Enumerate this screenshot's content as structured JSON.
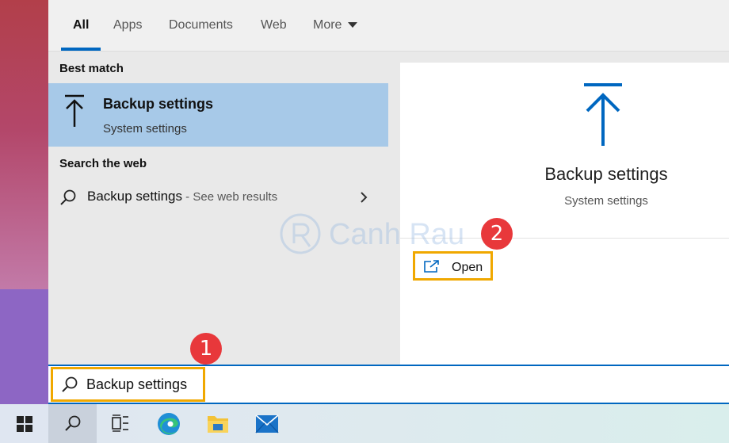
{
  "tabs": [
    {
      "label": "All",
      "active": true
    },
    {
      "label": "Apps"
    },
    {
      "label": "Documents"
    },
    {
      "label": "Web"
    },
    {
      "label": "More"
    }
  ],
  "left": {
    "best_match_heading": "Best match",
    "best_match": {
      "title": "Backup settings",
      "subtitle": "System settings",
      "icon": "backup-arrow-icon"
    },
    "web_heading": "Search the web",
    "web_result": {
      "text": "Backup settings",
      "hint": " - See web results"
    }
  },
  "preview": {
    "title": "Backup settings",
    "subtitle": "System settings",
    "open_label": "Open",
    "icon": "backup-arrow-icon"
  },
  "watermark": {
    "text": "Canh Rau"
  },
  "badges": {
    "one": "1",
    "two": "2"
  },
  "search": {
    "value": "Backup settings"
  },
  "taskbar": {
    "items": [
      "windows-start-icon",
      "search-icon",
      "task-view-icon",
      "edge-icon",
      "file-explorer-icon",
      "mail-icon"
    ]
  },
  "colors": {
    "accent": "#0067c0",
    "highlight": "#f0a800",
    "selection": "#a7c9e8",
    "badge": "#e8383b"
  }
}
